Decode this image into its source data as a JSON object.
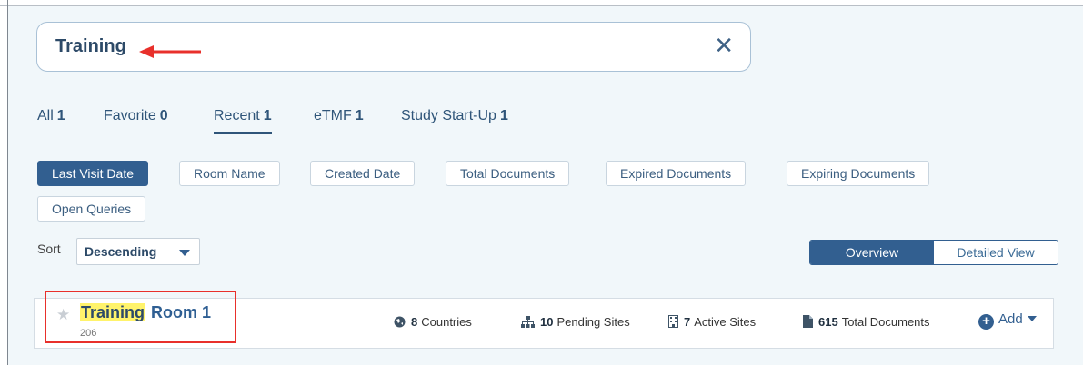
{
  "search": {
    "value": "Training",
    "clear_icon": "close-icon"
  },
  "tabs": [
    {
      "label": "All",
      "count": "1"
    },
    {
      "label": "Favorite",
      "count": "0"
    },
    {
      "label": "Recent",
      "count": "1"
    },
    {
      "label": "eTMF",
      "count": "1"
    },
    {
      "label": "Study Start-Up",
      "count": "1"
    }
  ],
  "sort_fields": [
    "Last Visit Date",
    "Room Name",
    "Created Date",
    "Total Documents",
    "Expired Documents",
    "Expiring Documents",
    "Open Queries"
  ],
  "sort": {
    "label": "Sort",
    "value": "Descending"
  },
  "views": {
    "overview": "Overview",
    "detailed": "Detailed View"
  },
  "room": {
    "highlight": "Training",
    "rest": "Room 1",
    "id": "206",
    "stats": [
      {
        "icon": "globe-icon",
        "value": "8",
        "label": "Countries"
      },
      {
        "icon": "sitemap-icon",
        "value": "10",
        "label": "Pending Sites"
      },
      {
        "icon": "building-icon",
        "value": "7",
        "label": "Active Sites"
      },
      {
        "icon": "file-icon",
        "value": "615",
        "label": "Total Documents"
      }
    ],
    "add_label": "Add"
  },
  "colors": {
    "accent": "#325f90",
    "highlight": "#fff36b",
    "annotation": "#e8302b"
  }
}
